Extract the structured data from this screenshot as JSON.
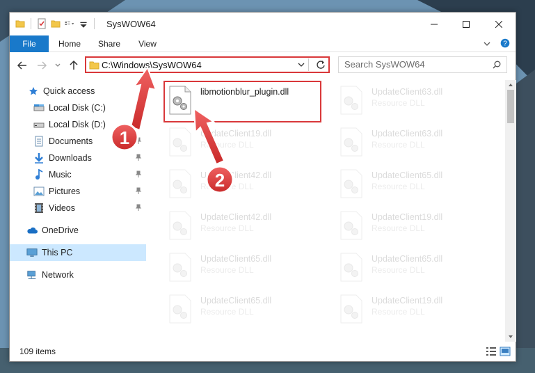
{
  "window": {
    "title": "SysWOW64"
  },
  "ribbon": {
    "tabs": [
      "File",
      "Home",
      "Share",
      "View"
    ]
  },
  "address": {
    "path": "C:\\Windows\\SysWOW64"
  },
  "search": {
    "placeholder": "Search SysWOW64"
  },
  "nav_pane": {
    "quick_access": "Quick access",
    "items": [
      {
        "label": "Local Disk (C:)",
        "icon": "drive-icon",
        "pinned": true
      },
      {
        "label": "Local Disk (D:)",
        "icon": "drive-icon",
        "pinned": true
      },
      {
        "label": "Documents",
        "icon": "documents-icon",
        "pinned": true
      },
      {
        "label": "Downloads",
        "icon": "downloads-icon",
        "pinned": true
      },
      {
        "label": "Music",
        "icon": "music-icon",
        "pinned": true
      },
      {
        "label": "Pictures",
        "icon": "pictures-icon",
        "pinned": true
      },
      {
        "label": "Videos",
        "icon": "videos-icon",
        "pinned": true
      }
    ],
    "onedrive": "OneDrive",
    "this_pc": "This PC",
    "network": "Network"
  },
  "files": [
    {
      "name": "libmotionblur_plugin.dll",
      "type": "",
      "highlighted": true
    },
    {
      "name": "UpdateClient63.dll",
      "type": "Resource DLL"
    },
    {
      "name": "UpdateClient19.dll",
      "type": "Resource DLL"
    },
    {
      "name": "UpdateClient63.dll",
      "type": "Resource DLL"
    },
    {
      "name": "UpdateClient42.dll",
      "type": "Resource DLL"
    },
    {
      "name": "UpdateClient65.dll",
      "type": "Resource DLL"
    },
    {
      "name": "UpdateClient42.dll",
      "type": "Resource DLL"
    },
    {
      "name": "UpdateClient19.dll",
      "type": "Resource DLL"
    },
    {
      "name": "UpdateClient65.dll",
      "type": "Resource DLL"
    },
    {
      "name": "UpdateClient65.dll",
      "type": "Resource DLL"
    },
    {
      "name": "UpdateClient65.dll",
      "type": "Resource DLL"
    },
    {
      "name": "UpdateClient19.dll",
      "type": "Resource DLL"
    }
  ],
  "status": {
    "item_count": "109 items"
  },
  "annotations": {
    "step1": "1",
    "step2": "2"
  },
  "colors": {
    "accent": "#1979ca",
    "highlight_red": "#d9383a",
    "selected": "#cce8ff"
  }
}
